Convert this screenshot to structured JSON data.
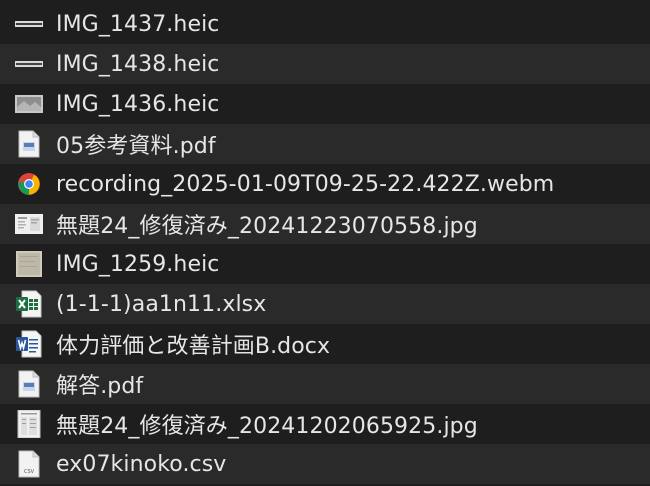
{
  "files": [
    {
      "name": "IMG_1437.heic",
      "icon": "heic-strip-thumbnail-icon"
    },
    {
      "name": "IMG_1438.heic",
      "icon": "heic-strip-thumbnail-icon"
    },
    {
      "name": "IMG_1436.heic",
      "icon": "heic-photo-thumbnail-icon"
    },
    {
      "name": "05参考資料.pdf",
      "icon": "pdf-document-icon"
    },
    {
      "name": "recording_2025-01-09T09-25-22.422Z.webm",
      "icon": "chrome-icon"
    },
    {
      "name": "無題24_修復済み_20241223070558.jpg",
      "icon": "jpg-thumbnail-icon"
    },
    {
      "name": "IMG_1259.heic",
      "icon": "heic-paper-thumbnail-icon"
    },
    {
      "name": "(1-1-1)aa1n11.xlsx",
      "icon": "excel-document-icon"
    },
    {
      "name": "体力評価と改善計画B.docx",
      "icon": "word-document-icon"
    },
    {
      "name": "解答.pdf",
      "icon": "pdf-document-icon"
    },
    {
      "name": "無題24_修復済み_20241202065925.jpg",
      "icon": "jpg-document-thumbnail-icon"
    },
    {
      "name": "ex07kinoko.csv",
      "icon": "csv-document-icon",
      "badge": "CSV"
    }
  ]
}
